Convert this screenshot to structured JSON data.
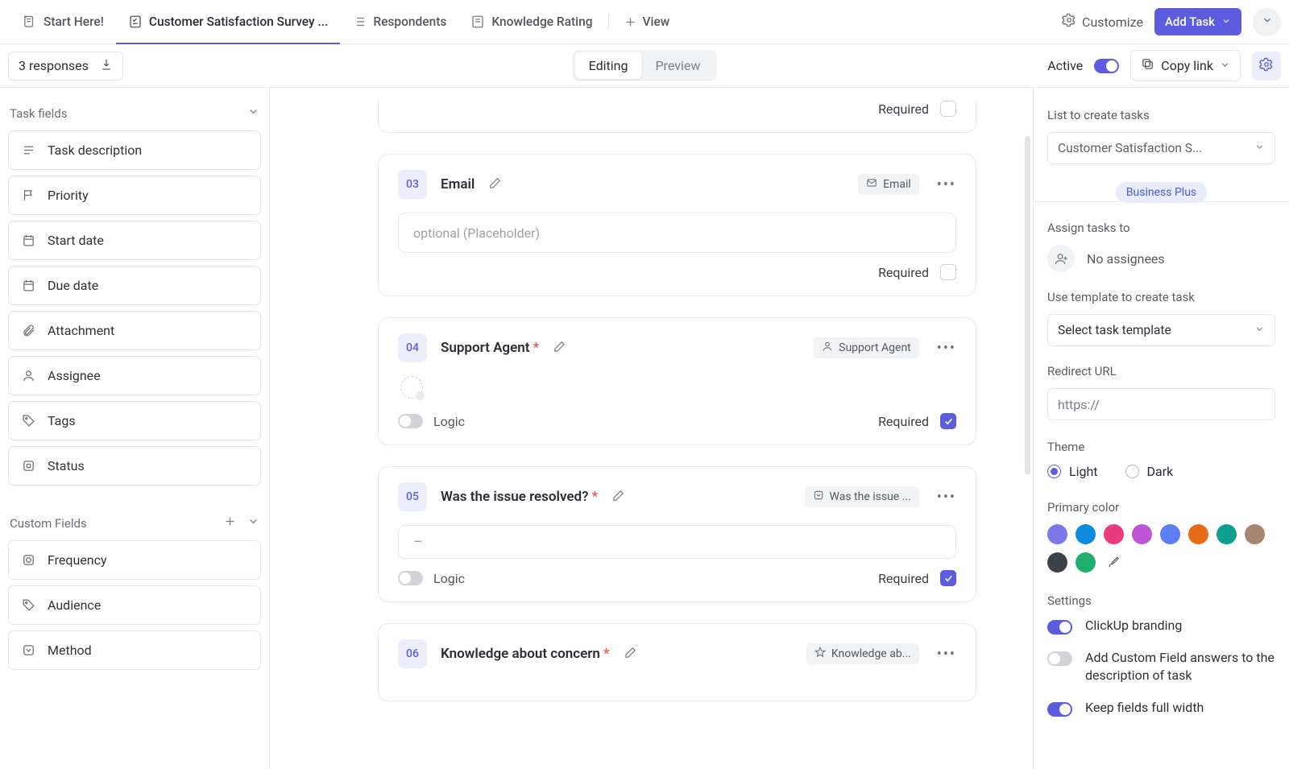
{
  "tabs": {
    "start": "Start Here!",
    "survey": "Customer Satisfaction Survey ...",
    "respondents": "Respondents",
    "knowledge": "Knowledge Rating",
    "view": "View"
  },
  "top": {
    "customize": "Customize",
    "add_task": "Add Task"
  },
  "sec": {
    "responses": "3 responses",
    "editing": "Editing",
    "preview": "Preview",
    "active": "Active",
    "copy": "Copy link"
  },
  "left": {
    "task_fields_header": "Task fields",
    "task_fields": [
      {
        "icon": "text-icon",
        "label": "Task description"
      },
      {
        "icon": "flag-icon",
        "label": "Priority"
      },
      {
        "icon": "calendar-icon",
        "label": "Start date"
      },
      {
        "icon": "calendar-icon",
        "label": "Due date"
      },
      {
        "icon": "clip-icon",
        "label": "Attachment"
      },
      {
        "icon": "person-icon",
        "label": "Assignee"
      },
      {
        "icon": "tag-icon",
        "label": "Tags"
      },
      {
        "icon": "status-icon",
        "label": "Status"
      }
    ],
    "custom_fields_header": "Custom Fields",
    "custom_fields": [
      {
        "icon": "sigma-icon",
        "label": "Frequency"
      },
      {
        "icon": "tag-icon",
        "label": "Audience"
      },
      {
        "icon": "down-icon",
        "label": "Method"
      }
    ]
  },
  "mid": {
    "required": "Required",
    "logic": "Logic",
    "placeholder": "optional (Placeholder)",
    "dash": "–",
    "q3": {
      "num": "03",
      "title": "Email",
      "chip": "Email"
    },
    "q4": {
      "num": "04",
      "title": "Support Agent",
      "chip": "Support Agent"
    },
    "q5": {
      "num": "05",
      "title": "Was the issue resolved?",
      "chip": "Was the issue ..."
    },
    "q6": {
      "num": "06",
      "title": "Knowledge about concern",
      "chip": "Knowledge ab..."
    }
  },
  "right": {
    "list_label": "List to create tasks",
    "list_value": "Customer Satisfaction S...",
    "plan": "Business Plus",
    "assign_label": "Assign tasks to",
    "no_assignees": "No assignees",
    "template_label": "Use template to create task",
    "template_value": "Select task template",
    "redirect_label": "Redirect URL",
    "redirect_placeholder": "https://",
    "theme_label": "Theme",
    "theme_light": "Light",
    "theme_dark": "Dark",
    "primary_label": "Primary color",
    "colors": [
      "#7b79e8",
      "#0f8ae0",
      "#ec3a82",
      "#bf55d9",
      "#5d7ff1",
      "#e86c17",
      "#0f9f8f",
      "#a88572",
      "#3d4249",
      "#1fae6e"
    ],
    "settings_label": "Settings",
    "branding": "ClickUp branding",
    "add_cf": "Add Custom Field answers to the description of task",
    "fullwidth": "Keep fields full width"
  }
}
